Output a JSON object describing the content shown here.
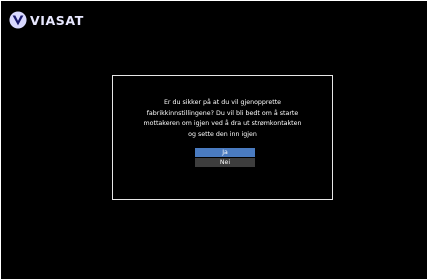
{
  "brand": {
    "name": "VIASAT",
    "logo_icon": "viasat-logo-icon"
  },
  "dialog": {
    "message_lines": [
      "Er du sikker på at du vil gjenopprette",
      "fabrikkinnstillingene? Du vil bli bedt om å starte",
      "mottakeren om igjen ved å dra ut strømkontakten",
      "og sette den inn igjen"
    ],
    "buttons": {
      "yes_label": "Ja",
      "no_label": "Nei"
    }
  },
  "colors": {
    "background": "#000000",
    "selected_button": "#4a7bc0",
    "unselected_button": "#3d3d3d",
    "dialog_border": "#e6e6e6"
  }
}
